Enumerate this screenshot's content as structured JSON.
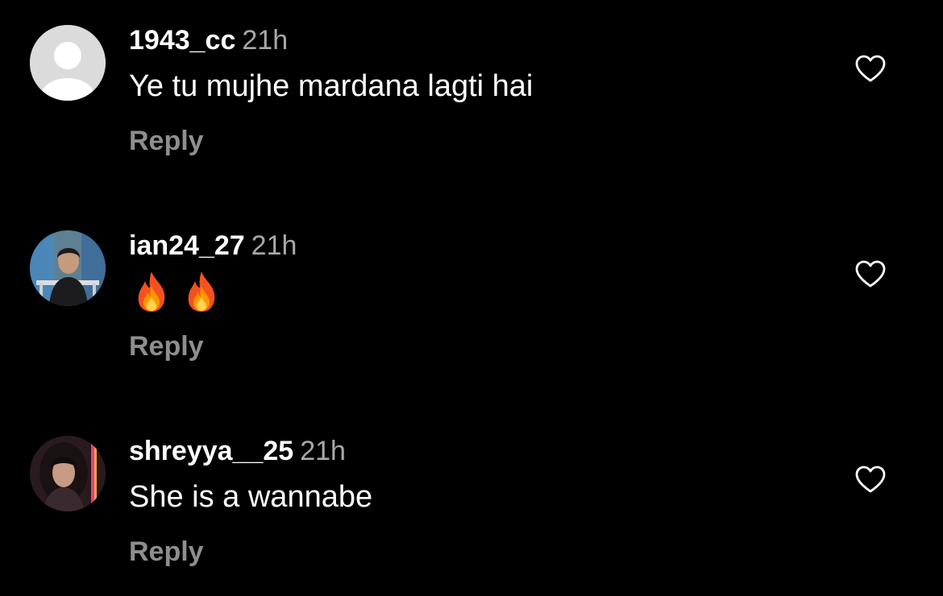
{
  "comments": [
    {
      "username": "1943_cc",
      "time": "21h",
      "text": "Ye tu mujhe mardana lagti hai",
      "reply_label": "Reply",
      "avatar": "default-avatar-icon"
    },
    {
      "username": "ian24_27",
      "time": "21h",
      "text": "🔥 🔥",
      "reply_label": "Reply",
      "avatar": "profile-photo"
    },
    {
      "username": "shreyya__25",
      "time": "21h",
      "text": "She is a wannabe",
      "reply_label": "Reply",
      "avatar": "profile-photo"
    }
  ],
  "icons": {
    "like": "heart-outline-icon",
    "emoji": "fire-emoji"
  },
  "colors": {
    "background": "#000000",
    "text": "#ffffff",
    "secondary": "#a8a8a8",
    "reply": "#8e8e8e"
  }
}
